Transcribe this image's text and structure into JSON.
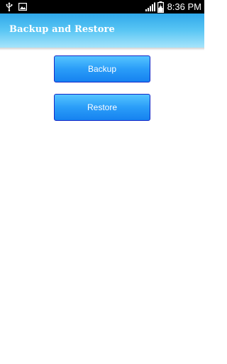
{
  "status_bar": {
    "time": "8:36 PM",
    "icons": [
      "usb-icon",
      "image-icon",
      "signal-icon",
      "battery-charging-icon"
    ]
  },
  "action_bar": {
    "title": "Backup and Restore"
  },
  "buttons": {
    "backup_label": "Backup",
    "restore_label": "Restore"
  },
  "colors": {
    "action_bar_top": "#2fa8ea",
    "action_bar_bottom": "#a6e4fb",
    "button_fill": "#2a9df8",
    "button_border": "#1428c8"
  }
}
